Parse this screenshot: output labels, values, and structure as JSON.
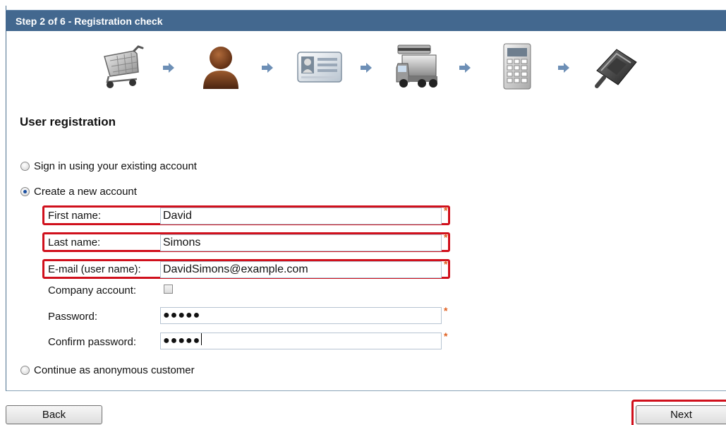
{
  "header": {
    "title": "Step 2 of 6 - Registration check"
  },
  "steps": [
    {
      "icon": "shopping-cart-icon"
    },
    {
      "icon": "user-icon"
    },
    {
      "icon": "id-card-icon"
    },
    {
      "icon": "delivery-truck-icon"
    },
    {
      "icon": "calculator-icon"
    },
    {
      "icon": "payment-card-reader-icon"
    }
  ],
  "section": {
    "title": "User registration"
  },
  "options": {
    "sign_in": "Sign in using your existing account",
    "create_new": "Create a new account",
    "anonymous": "Continue as anonymous customer",
    "selected": "create_new"
  },
  "form": {
    "first_name": {
      "label": "First name:",
      "value": "David",
      "required": "*"
    },
    "last_name": {
      "label": "Last name:",
      "value": "Simons",
      "required": "*"
    },
    "email": {
      "label": "E-mail (user name):",
      "value": "DavidSimons@example.com",
      "required": "*"
    },
    "company_account": {
      "label": "Company account:",
      "checked": false
    },
    "password": {
      "label": "Password:",
      "value": "●●●●●",
      "required": "*"
    },
    "confirm_password": {
      "label": "Confirm password:",
      "value": "●●●●●",
      "required": "*"
    }
  },
  "buttons": {
    "back": "Back",
    "next": "Next"
  },
  "colors": {
    "header": "#43688f",
    "highlight": "#d0101c",
    "required": "#e06020"
  }
}
